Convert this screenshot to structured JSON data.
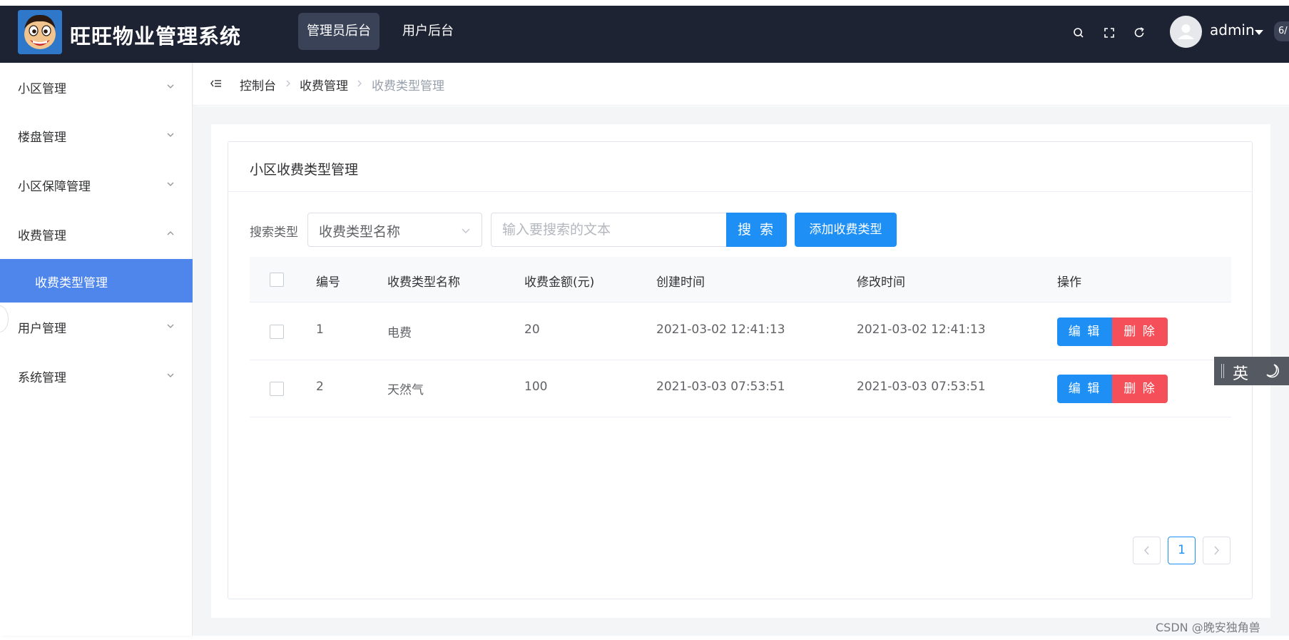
{
  "header": {
    "app_title": "旺旺物业管理系统",
    "tabs": [
      {
        "label": "管理员后台",
        "active": true
      },
      {
        "label": "用户后台",
        "active": false
      }
    ],
    "icons": [
      "search-icon",
      "fullscreen-icon",
      "refresh-icon"
    ],
    "user": {
      "name": "admin"
    },
    "badge_text": "6/"
  },
  "sidebar": {
    "items": [
      {
        "label": "小区管理",
        "expanded": false
      },
      {
        "label": "楼盘管理",
        "expanded": false
      },
      {
        "label": "小区保障管理",
        "expanded": false
      },
      {
        "label": "收费管理",
        "expanded": true
      },
      {
        "label": "用户管理",
        "expanded": false
      },
      {
        "label": "系统管理",
        "expanded": false
      }
    ],
    "active_subitem": {
      "label": "收费类型管理"
    }
  },
  "breadcrumb": {
    "items": [
      "控制台",
      "收费管理",
      "收费类型管理"
    ]
  },
  "card": {
    "title": "小区收费类型管理"
  },
  "search": {
    "label": "搜索类型",
    "select_value": "收费类型名称",
    "input_placeholder": "输入要搜索的文本",
    "search_button": "搜 索",
    "add_button": "添加收费类型"
  },
  "table": {
    "headers": [
      "编号",
      "收费类型名称",
      "收费金额(元)",
      "创建时间",
      "修改时间",
      "操作"
    ],
    "rows": [
      {
        "id": "1",
        "name": "电费",
        "amount": "20",
        "created": "2021-03-02 12:41:13",
        "modified": "2021-03-02 12:41:13"
      },
      {
        "id": "2",
        "name": "天然气",
        "amount": "100",
        "created": "2021-03-03 07:53:51",
        "modified": "2021-03-03 07:53:51"
      }
    ],
    "edit_label": "编 辑",
    "delete_label": "删 除"
  },
  "pagination": {
    "current_page": "1"
  },
  "ime": {
    "text": "英"
  },
  "watermark": "CSDN @晚安独角兽",
  "colors": {
    "topbar": "#1e2334",
    "primary": "#1e90f5",
    "danger": "#f5505a",
    "active_menu": "#4f86ec"
  }
}
